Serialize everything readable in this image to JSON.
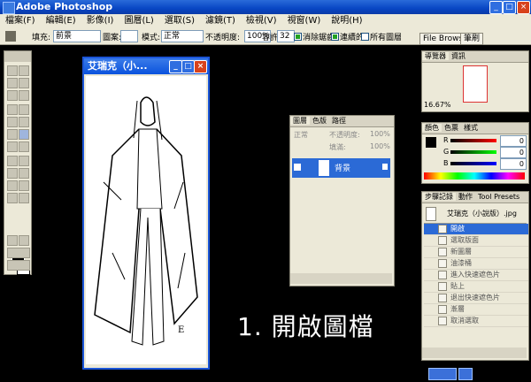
{
  "app": {
    "title": "Adobe Photoshop"
  },
  "menu": [
    "檔案(F)",
    "編輯(E)",
    "影像(I)",
    "圖層(L)",
    "選取(S)",
    "濾鏡(T)",
    "檢視(V)",
    "視窗(W)",
    "說明(H)"
  ],
  "options": {
    "mode_label": "模式:",
    "mode_value": "正常",
    "opacity_label": "不透明度:",
    "opacity_value": "100%",
    "tolerance_label": "容許:",
    "tolerance_value": "32",
    "antialias_label": "消除鋸齒",
    "contiguous_label": "連續的",
    "all_layers_label": "所有圖層",
    "fill_label": "填充:",
    "fill_value": "前景",
    "pattern_label": "圖案:",
    "file_browser": "File Browser",
    "brushes": "筆刷"
  },
  "document": {
    "title": "艾瑞克（小..."
  },
  "navigator": {
    "tabs": [
      "導覽器",
      "資訊"
    ],
    "zoom": "16.67%"
  },
  "color_panel": {
    "tabs": [
      "顏色",
      "色票",
      "樣式"
    ],
    "channels": [
      {
        "label": "R",
        "value": "0"
      },
      {
        "label": "G",
        "value": "0"
      },
      {
        "label": "B",
        "value": "0"
      }
    ]
  },
  "layers_panel": {
    "tabs": [
      "圖層",
      "色版",
      "路徑"
    ],
    "blend_mode": "正常",
    "opacity_label": "不透明度:",
    "opacity_value": "100%",
    "fill_label": "填滿:",
    "fill_value": "100%",
    "layer_name": "背景"
  },
  "history_panel": {
    "tabs": [
      "步驟記錄",
      "動作",
      "Tool Presets"
    ],
    "snapshot": "艾瑞克（小說版）.jpg",
    "steps": [
      "開啟",
      "選取版面",
      "新圖層",
      "油漆桶",
      "進入快速遮色片",
      "貼上",
      "退出快速遮色片",
      "漸層",
      "取消選取"
    ]
  },
  "caption": "1. 開啟圖檔",
  "colors": {
    "accent": "#1b55d8",
    "title": "#0a52dd",
    "highlight": "#2b6ad6"
  }
}
